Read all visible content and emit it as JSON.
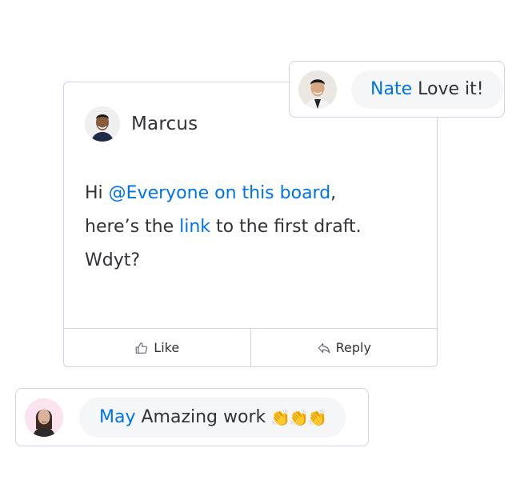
{
  "post": {
    "author": "Marcus",
    "author_avatar_icon": "person-avatar",
    "body": {
      "line1_prefix": "Hi ",
      "mention": "@Everyone on this board",
      "line1_suffix": ",",
      "line2_prefix": "here’s the ",
      "link_text": "link",
      "line2_suffix": " to the first draft.",
      "line3": "Wdyt?"
    },
    "actions": {
      "like_label": "Like",
      "like_icon": "thumbs-up-icon",
      "reply_label": "Reply",
      "reply_icon": "reply-arrow-icon"
    }
  },
  "replies": [
    {
      "name": "Nate",
      "text": "Love it!",
      "emoji": ""
    },
    {
      "name": "May",
      "text": "Amazing work",
      "emoji": "👏👏👏"
    }
  ],
  "colors": {
    "accent": "#0073ea",
    "text": "#323338",
    "border": "#d0d4e4",
    "bubble": "#f5f6f8"
  }
}
